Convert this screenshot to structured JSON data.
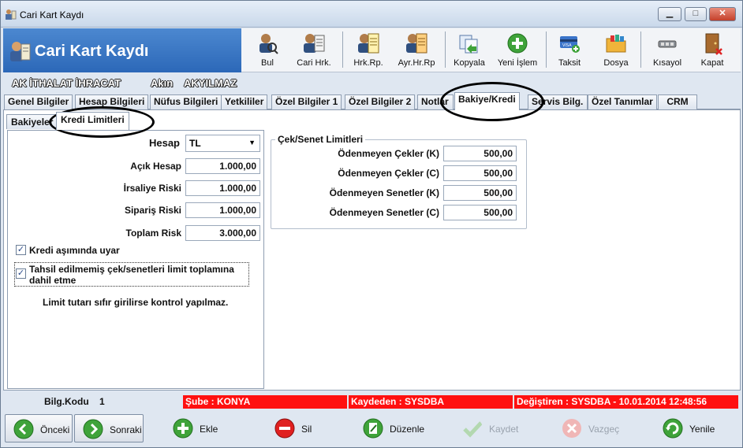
{
  "window": {
    "title": "Cari Kart Kaydı",
    "min": "▁",
    "max": "□",
    "close": "✕"
  },
  "app": {
    "title": "Cari Kart Kaydı"
  },
  "toolbar": [
    {
      "label": "Bul",
      "icon": "search-person-icon"
    },
    {
      "label": "Cari Hrk.",
      "icon": "account-moves-icon"
    },
    {
      "label": "Hrk.Rp.",
      "icon": "moves-report-icon"
    },
    {
      "label": "Ayr.Hr.Rp",
      "icon": "detailed-report-icon"
    },
    {
      "label": "Kopyala",
      "icon": "copy-icon"
    },
    {
      "label": "Yeni İşlem",
      "icon": "new-transaction-icon"
    },
    {
      "label": "Taksit",
      "icon": "installment-card-icon"
    },
    {
      "label": "Dosya",
      "icon": "folder-icon"
    },
    {
      "label": "Kısayol",
      "icon": "shortcut-icon"
    },
    {
      "label": "Kapat",
      "icon": "exit-door-icon"
    }
  ],
  "owner": {
    "company": "AK İTHALAT İHRACAT",
    "first": "Akın",
    "last": "AKYILMAZ"
  },
  "tabs": [
    "Genel Bilgiler",
    "Hesap Bilgileri",
    "Nüfus Bilgileri",
    "Yetkililer",
    "Özel Bilgiler 1",
    "Özel Bilgiler 2",
    "Notlar",
    "Bakiye/Kredi",
    "Servis Bilg.",
    "Özel Tanımlar",
    "CRM"
  ],
  "subtabs": [
    "Bakiyeler",
    "Kredi Limitleri"
  ],
  "credit": {
    "hesap_label": "Hesap",
    "hesap_value": "TL",
    "acik_hesap_label": "Açık Hesap",
    "acik_hesap": "1.000,00",
    "irsaliye_label": "İrsaliye Riski",
    "irsaliye": "1.000,00",
    "siparis_label": "Sipariş Riski",
    "siparis": "1.000,00",
    "toplam_label": "Toplam Risk",
    "toplam": "3.000,00",
    "warn_label": "Kredi aşımında uyar",
    "include_label_1": "Tahsil edilmemiş çek/senetleri limit toplamına",
    "include_label_2": "dahil etme",
    "note": "Limit tutarı sıfır girilirse kontrol yapılmaz."
  },
  "cek": {
    "title": "Çek/Senet Limitleri",
    "rows": [
      {
        "label": "Ödenmeyen Çekler (K)",
        "value": "500,00"
      },
      {
        "label": "Ödenmeyen Çekler (C)",
        "value": "500,00"
      },
      {
        "label": "Ödenmeyen Senetler (K)",
        "value": "500,00"
      },
      {
        "label": "Ödenmeyen Senetler (C)",
        "value": "500,00"
      }
    ]
  },
  "status": {
    "bilg_label": "Bilg.Kodu",
    "bilg_value": "1",
    "sube": "Şube : KONYA",
    "kaydeden": "Kaydeden : SYSDBA",
    "degistiren": "Değiştiren : SYSDBA - 10.01.2014 12:48:56"
  },
  "buttons": {
    "onceki": "Önceki",
    "sonraki": "Sonraki",
    "ekle": "Ekle",
    "sil": "Sil",
    "duzenle": "Düzenle",
    "kaydet": "Kaydet",
    "vazgec": "Vazgeç",
    "yenile": "Yenile"
  },
  "colors": {
    "banner": "#2c68b8",
    "status_red": "#ff1010",
    "green": "#3fa33a"
  }
}
